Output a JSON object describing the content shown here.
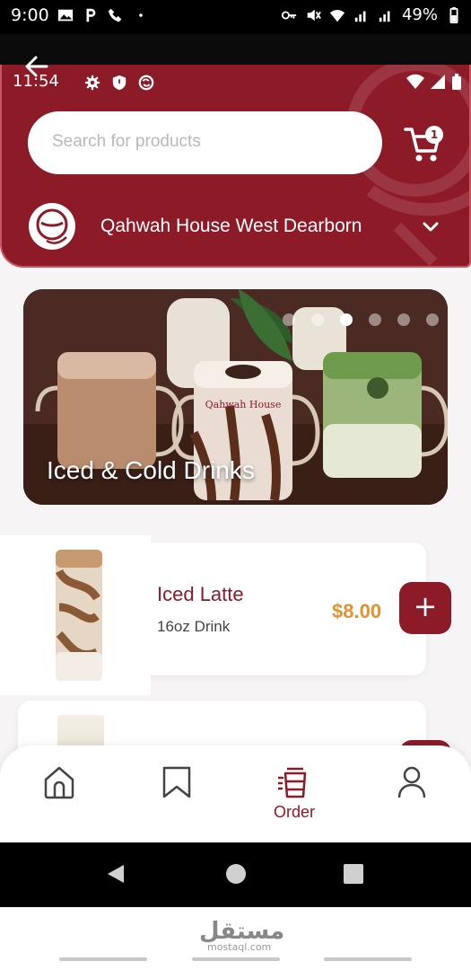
{
  "device_status": {
    "time": "9:00",
    "battery": "49%"
  },
  "app_status": {
    "time": "11:54"
  },
  "search": {
    "placeholder": "Search for products"
  },
  "cart": {
    "count": "1"
  },
  "store": {
    "name": "Qahwah House West Dearborn"
  },
  "banner": {
    "title": "Iced & Cold Drinks",
    "slide_count": 6,
    "active_slide": 4,
    "cup_print": "Qahwah House"
  },
  "products": [
    {
      "name": "Iced Latte",
      "description": "16oz Drink",
      "price": "$8.00",
      "add_label": "+"
    }
  ],
  "nav": {
    "order_label": "Order",
    "active": "order"
  },
  "watermark": {
    "brand": "مستقل",
    "domain": "mostaql.com"
  },
  "colors": {
    "brand": "#8c1a27",
    "price": "#e0932e"
  }
}
